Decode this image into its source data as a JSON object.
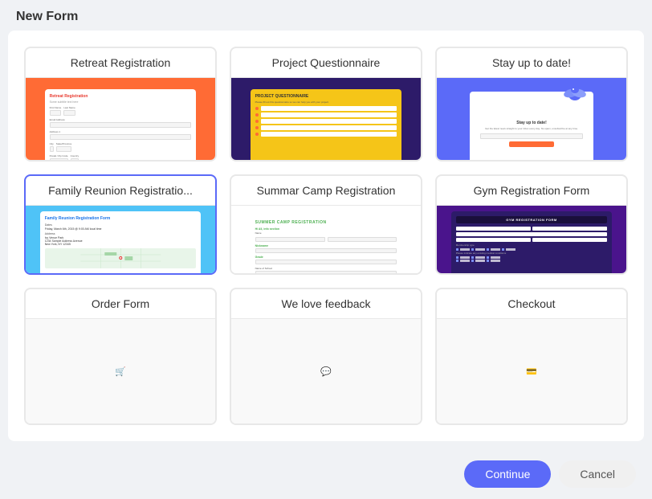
{
  "header": {
    "title": "New Form"
  },
  "templates": [
    {
      "id": "retreat-registration",
      "label": "Retreat Registration",
      "preview_type": "retreat",
      "selected": false
    },
    {
      "id": "project-questionnaire",
      "label": "Project Questionnaire",
      "preview_type": "project",
      "selected": false
    },
    {
      "id": "stay-up-to-date",
      "label": "Stay up to date!",
      "preview_type": "stayup",
      "selected": false
    },
    {
      "id": "family-reunion",
      "label": "Family Reunion Registratio...",
      "preview_type": "family",
      "selected": true
    },
    {
      "id": "summer-camp",
      "label": "Summar Camp Registration",
      "preview_type": "summer",
      "selected": false
    },
    {
      "id": "gym-registration",
      "label": "Gym Registration Form",
      "preview_type": "gym",
      "selected": false
    },
    {
      "id": "order-form",
      "label": "Order Form",
      "preview_type": "text",
      "selected": false
    },
    {
      "id": "we-love-feedback",
      "label": "We love feedback",
      "preview_type": "text",
      "selected": false
    },
    {
      "id": "checkout",
      "label": "Checkout",
      "preview_type": "text",
      "selected": false
    }
  ],
  "footer": {
    "continue_label": "Continue",
    "cancel_label": "Cancel"
  }
}
